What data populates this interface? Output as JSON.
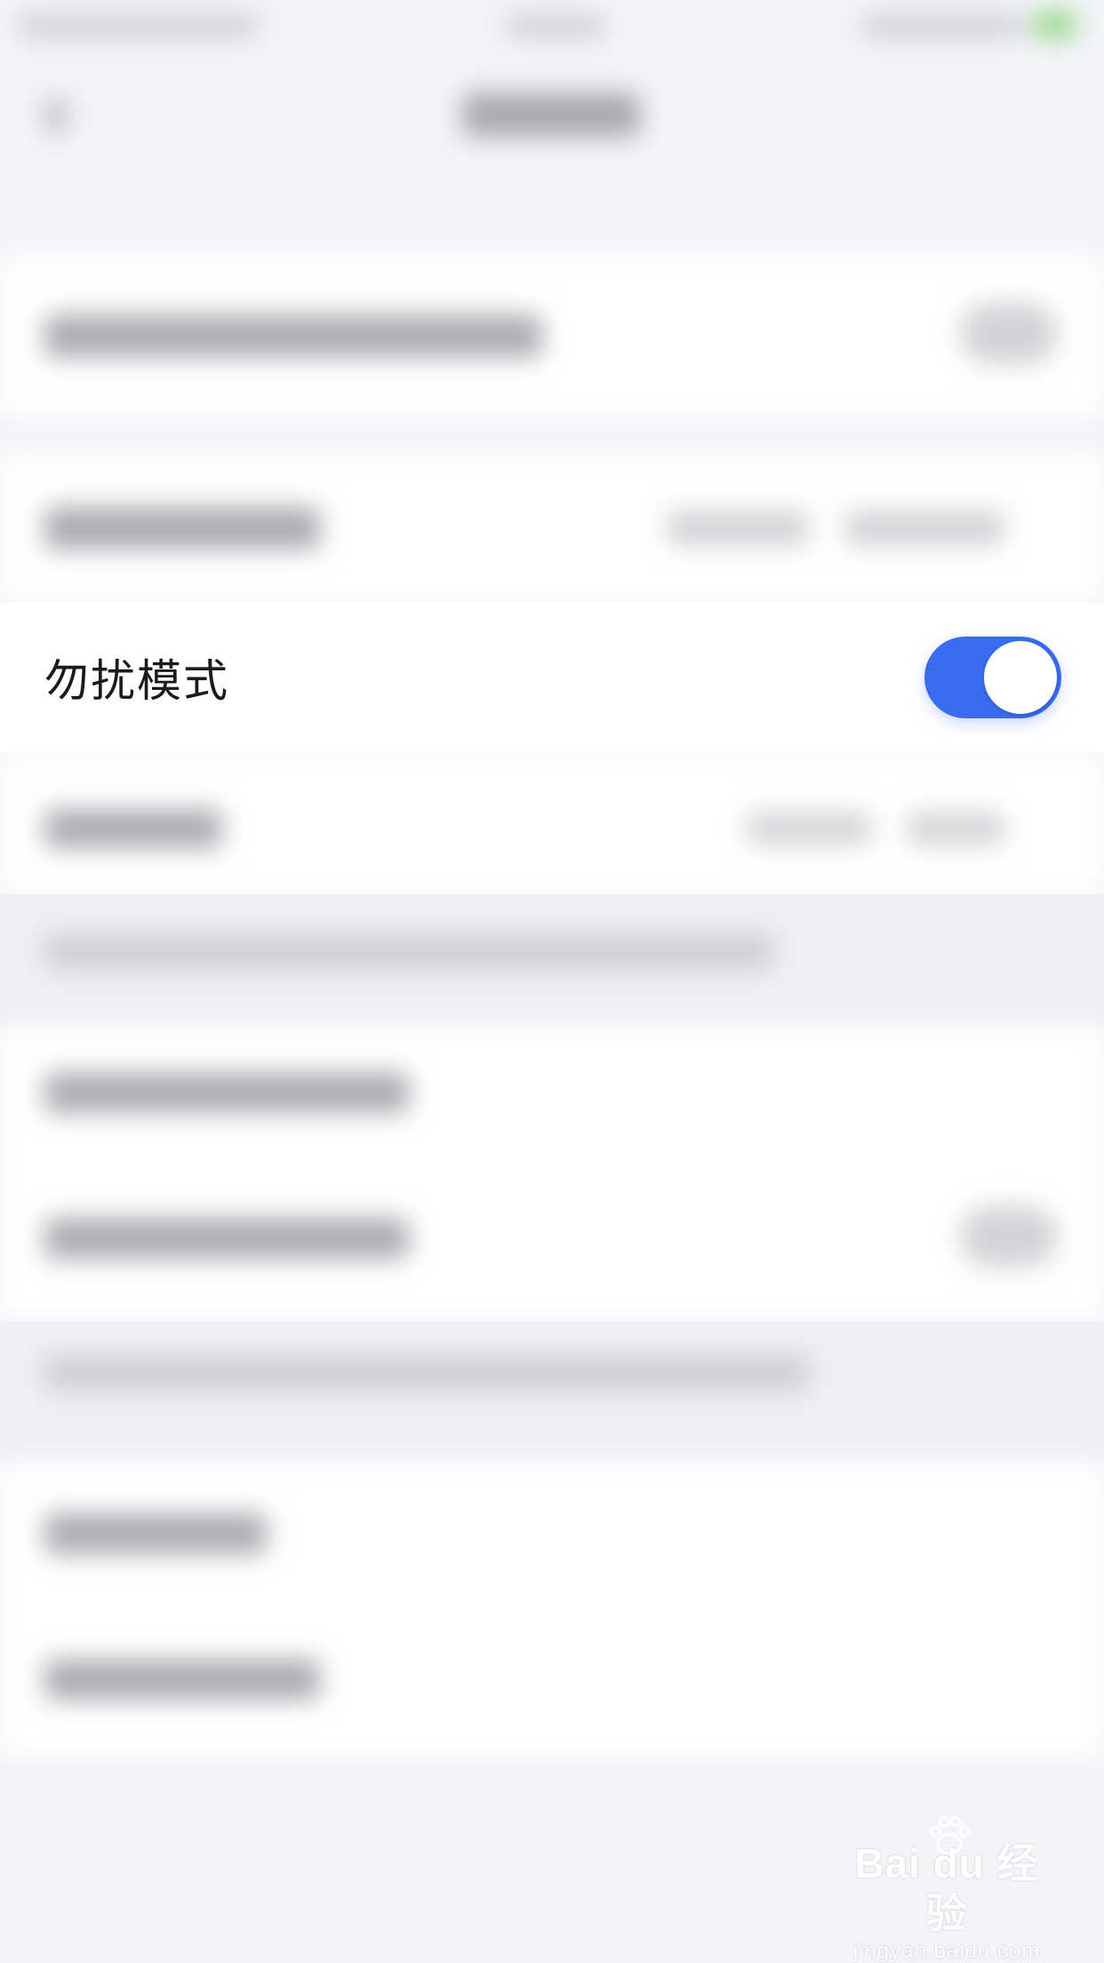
{
  "setting": {
    "label": "勿扰模式",
    "toggle_on": true,
    "accent_color": "#3a6cf2"
  },
  "watermark": {
    "brand": "Bai du 经验",
    "url": "jingyan.baidu.com"
  },
  "icons": {
    "back": "chevron-left-icon",
    "watermark_logo": "paw-icon"
  }
}
